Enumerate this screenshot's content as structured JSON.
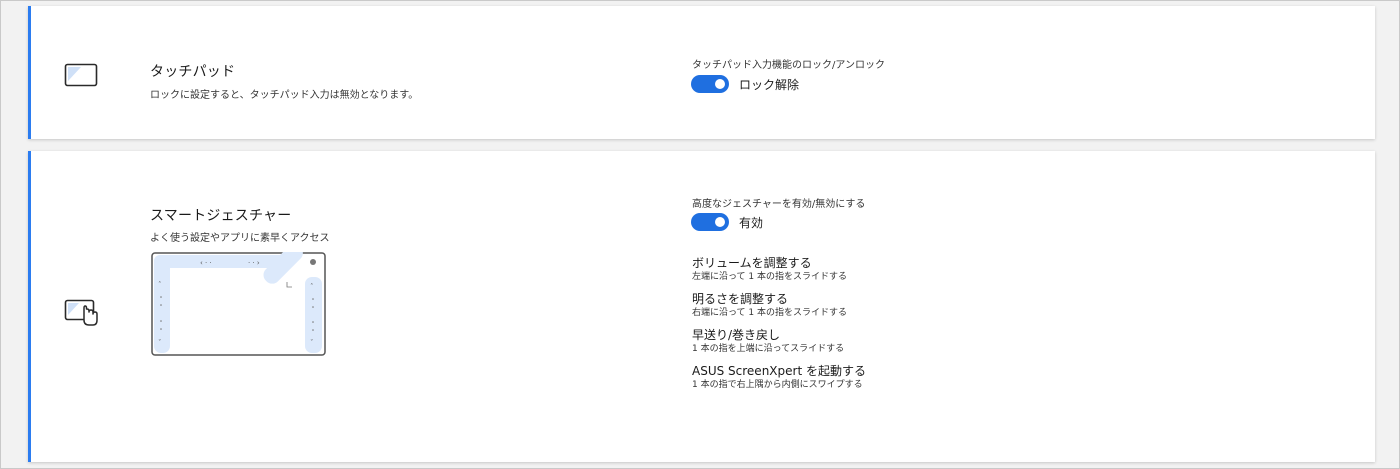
{
  "touchpad": {
    "icon": "touchpad-icon",
    "title": "タッチパッド",
    "description": "ロックに設定すると、タッチパッド入力は無効となります。",
    "setting_label": "タッチパッド入力機能のロック/アンロック",
    "toggle_on": true,
    "toggle_text": "ロック解除"
  },
  "gesture": {
    "icon": "touchpad-hand-icon",
    "title": "スマートジェスチャー",
    "description": "よく使う設定やアプリに素早くアクセス",
    "setting_label": "高度なジェスチャーを有効/無効にする",
    "toggle_on": true,
    "toggle_text": "有効",
    "items": [
      {
        "title": "ボリュームを調整する",
        "sub": "左端に沿って 1 本の指をスライドする"
      },
      {
        "title": "明るさを調整する",
        "sub": "右端に沿って 1 本の指をスライドする"
      },
      {
        "title": "早送り/巻き戻し",
        "sub": "1 本の指を上端に沿ってスライドする"
      },
      {
        "title": "ASUS ScreenXpert を起動する",
        "sub": "1 本の指で右上隅から内側にスワイプする"
      }
    ]
  },
  "colors": {
    "accent": "#1f6fe0",
    "card_border": "#2b7cf0",
    "diagram_highlight": "#dce9fb"
  }
}
